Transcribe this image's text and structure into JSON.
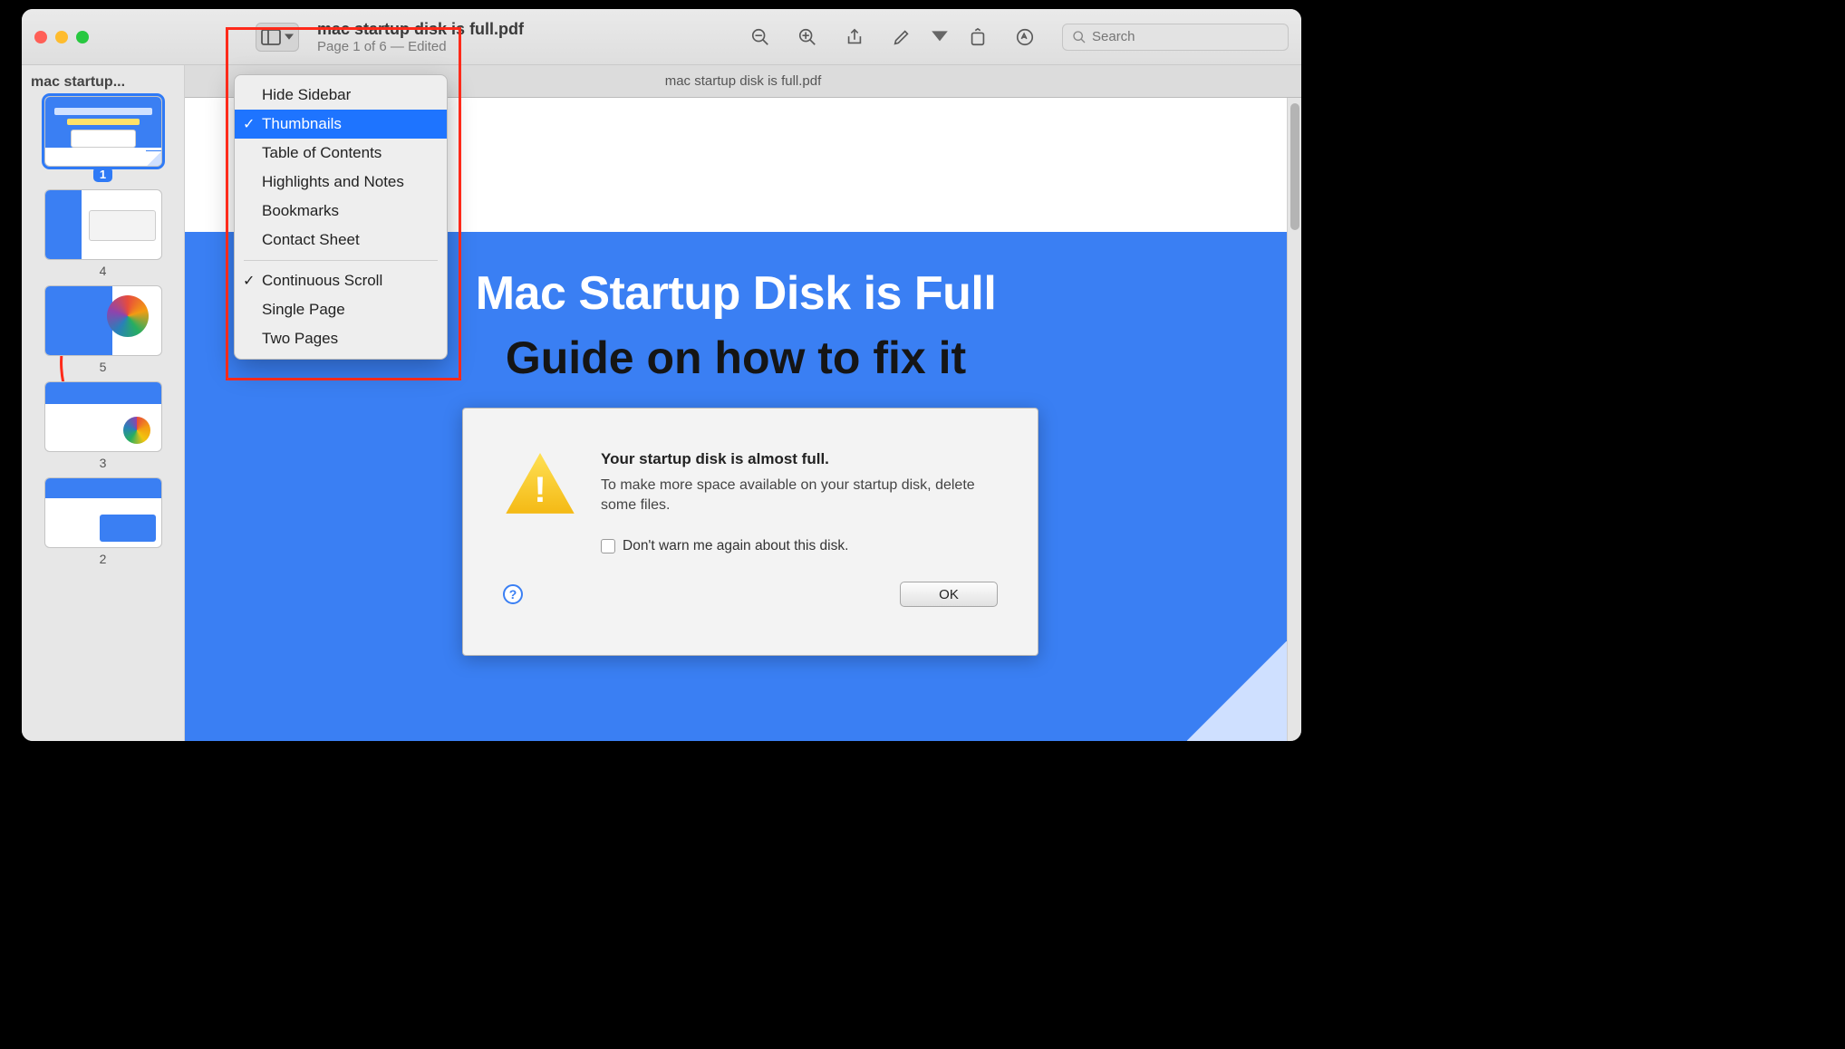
{
  "window": {
    "title": "mac startup disk is full.pdf",
    "subtitle": "Page 1 of 6 — Edited",
    "tab_label": "mac startup disk is full.pdf"
  },
  "toolbar": {
    "search_placeholder": "Search"
  },
  "sidebar": {
    "title": "mac startup...",
    "pages": [
      {
        "label": "1",
        "selected": true
      },
      {
        "label": "4",
        "selected": false
      },
      {
        "label": "5",
        "selected": false
      },
      {
        "label": "3",
        "selected": false
      },
      {
        "label": "2",
        "selected": false
      }
    ]
  },
  "menu": {
    "group1": [
      {
        "label": "Hide Sidebar",
        "checked": false
      },
      {
        "label": "Thumbnails",
        "checked": true,
        "highlight": true
      },
      {
        "label": "Table of Contents",
        "checked": false
      },
      {
        "label": "Highlights and Notes",
        "checked": false
      },
      {
        "label": "Bookmarks",
        "checked": false
      },
      {
        "label": "Contact Sheet",
        "checked": false
      }
    ],
    "group2": [
      {
        "label": "Continuous Scroll",
        "checked": true
      },
      {
        "label": "Single Page",
        "checked": false
      },
      {
        "label": "Two Pages",
        "checked": false
      }
    ]
  },
  "document": {
    "headline": "Mac Startup Disk is Full",
    "subhead": "Guide on how to fix it",
    "dialog": {
      "title": "Your startup disk is almost full.",
      "message": "To make more space available on your startup disk, delete some files.",
      "checkbox_label": "Don't warn me again about this disk.",
      "ok_label": "OK",
      "help": "?"
    }
  }
}
